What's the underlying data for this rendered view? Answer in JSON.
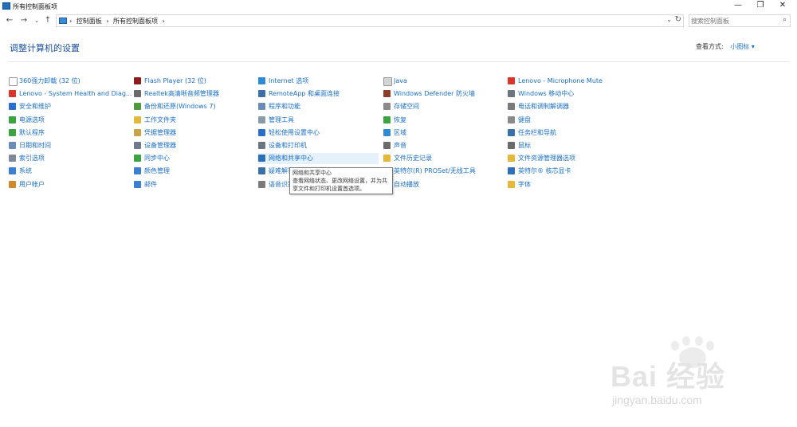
{
  "window": {
    "title": "所有控制面板项"
  },
  "address": {
    "crumbs": [
      "控制面板",
      "所有控制面板项"
    ]
  },
  "search": {
    "placeholder": "搜索控制面板"
  },
  "header": {
    "title": "调整计算机的设置",
    "view_by_label": "查看方式:",
    "view_by_value": "小图标 ▾"
  },
  "columns": [
    [
      {
        "label": "360强力卸载 (32 位)",
        "icon": "uninstall-icon",
        "color": "#ffffff"
      },
      {
        "label": "Lenovo - System Health and Diag...",
        "icon": "lenovo-health-icon",
        "color": "#d9362b"
      },
      {
        "label": "安全和维护",
        "icon": "flag-icon",
        "color": "#2a6fd0"
      },
      {
        "label": "电源选项",
        "icon": "power-icon",
        "color": "#3aa540"
      },
      {
        "label": "默认程序",
        "icon": "default-programs-icon",
        "color": "#3aa540"
      },
      {
        "label": "日期和时间",
        "icon": "clock-icon",
        "color": "#6a8db8"
      },
      {
        "label": "索引选项",
        "icon": "index-icon",
        "color": "#7c8a99"
      },
      {
        "label": "系统",
        "icon": "system-icon",
        "color": "#3b7fd4"
      },
      {
        "label": "用户帐户",
        "icon": "user-accounts-icon",
        "color": "#d08a2a"
      }
    ],
    [
      {
        "label": "Flash Player (32 位)",
        "icon": "flash-icon",
        "color": "#8c1b1b"
      },
      {
        "label": "Realtek高清晰音频管理器",
        "icon": "audio-manager-icon",
        "color": "#6b6b6b"
      },
      {
        "label": "备份和还原(Windows 7)",
        "icon": "backup-icon",
        "color": "#4f9a3d"
      },
      {
        "label": "工作文件夹",
        "icon": "folder-icon",
        "color": "#e6b83a"
      },
      {
        "label": "凭据管理器",
        "icon": "credential-icon",
        "color": "#c9a34a"
      },
      {
        "label": "设备管理器",
        "icon": "device-manager-icon",
        "color": "#6d7b8c"
      },
      {
        "label": "同步中心",
        "icon": "sync-icon",
        "color": "#3aa540"
      },
      {
        "label": "颜色管理",
        "icon": "color-management-icon",
        "color": "#3b7fd4"
      },
      {
        "label": "邮件",
        "icon": "mail-icon",
        "color": "#3b7fd4"
      }
    ],
    [
      {
        "label": "Internet 选项",
        "icon": "internet-icon",
        "color": "#2d8ad3"
      },
      {
        "label": "RemoteApp 和桌面连接",
        "icon": "remoteapp-icon",
        "color": "#3b6fa8"
      },
      {
        "label": "程序和功能",
        "icon": "programs-icon",
        "color": "#6a8db8"
      },
      {
        "label": "管理工具",
        "icon": "admin-tools-icon",
        "color": "#8a9aa8"
      },
      {
        "label": "轻松使用设置中心",
        "icon": "ease-of-access-icon",
        "color": "#2b6ec7"
      },
      {
        "label": "设备和打印机",
        "icon": "printer-icon",
        "color": "#6b7480"
      },
      {
        "label": "网络和共享中心",
        "icon": "network-icon",
        "color": "#2d6fb8"
      },
      {
        "label": "疑难解答",
        "icon": "troubleshoot-icon",
        "color": "#3b6fa8"
      },
      {
        "label": "语音识别",
        "icon": "microphone-icon",
        "color": "#7a7a7a"
      }
    ],
    [
      {
        "label": "Java",
        "icon": "java-icon",
        "color": "#d4d4d4"
      },
      {
        "label": "Windows Defender 防火墙",
        "icon": "firewall-icon",
        "color": "#8b3d2a"
      },
      {
        "label": "存储空间",
        "icon": "storage-icon",
        "color": "#8a8a8a"
      },
      {
        "label": "恢复",
        "icon": "recovery-icon",
        "color": "#3aa540"
      },
      {
        "label": "区域",
        "icon": "region-icon",
        "color": "#2d8ad3"
      },
      {
        "label": "声音",
        "icon": "sound-icon",
        "color": "#6b6b6b"
      },
      {
        "label": "文件历史记录",
        "icon": "file-history-icon",
        "color": "#e6b83a"
      },
      {
        "label": "英特尔(R) PROSet/无线工具",
        "icon": "wireless-icon",
        "color": "#2d6fb8"
      },
      {
        "label": "自动播放",
        "icon": "autoplay-icon",
        "color": "#3aa540"
      }
    ],
    [
      {
        "label": "Lenovo - Microphone Mute",
        "icon": "mic-mute-icon",
        "color": "#d9362b"
      },
      {
        "label": "Windows 移动中心",
        "icon": "mobility-center-icon",
        "color": "#6b7480"
      },
      {
        "label": "电话和调制解调器",
        "icon": "phone-icon",
        "color": "#7a7a7a"
      },
      {
        "label": "键盘",
        "icon": "keyboard-icon",
        "color": "#8a8a8a"
      },
      {
        "label": "任务栏和导航",
        "icon": "taskbar-icon",
        "color": "#3b6fa8"
      },
      {
        "label": "鼠标",
        "icon": "mouse-icon",
        "color": "#6b6b6b"
      },
      {
        "label": "文件资源管理器选项",
        "icon": "folder-options-icon",
        "color": "#e6b83a"
      },
      {
        "label": "英特尔® 核芯显卡",
        "icon": "intel-graphics-icon",
        "color": "#2d6fb8"
      },
      {
        "label": "字体",
        "icon": "fonts-icon",
        "color": "#e6b83a"
      }
    ]
  ],
  "tooltip": {
    "title": "网络和共享中心",
    "body": "查看网络状态、更改网络设置，并为共享文件和打印机设置首选项。"
  },
  "watermark": {
    "brand": "Bai 经验",
    "url": "jingyan.baidu.com"
  }
}
